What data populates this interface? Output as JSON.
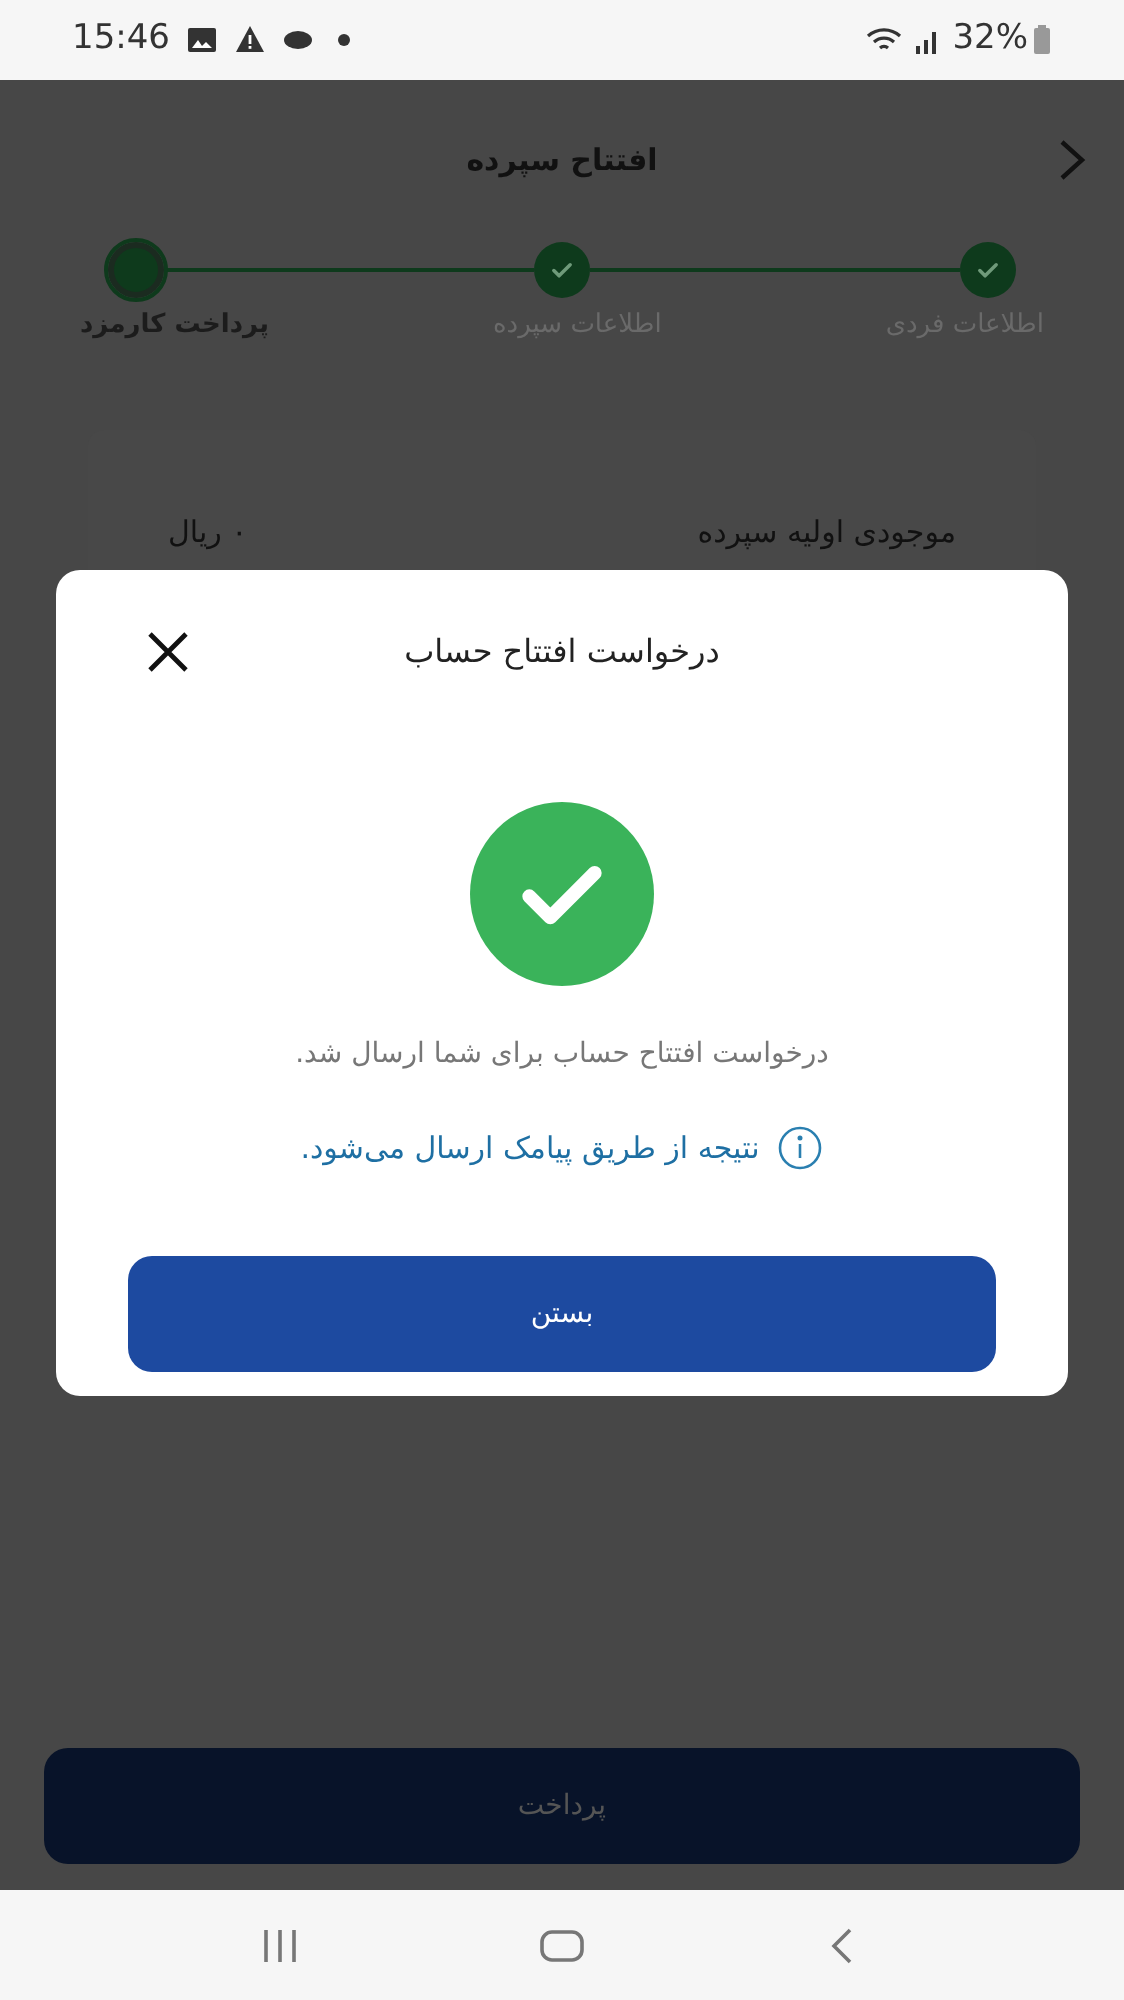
{
  "status_bar": {
    "time": "15:46",
    "battery": "32%"
  },
  "header": {
    "title": "افتتاح سپرده"
  },
  "steps": [
    {
      "label": "اطلاعات فردی",
      "completed": true
    },
    {
      "label": "اطلاعات سپرده",
      "completed": true
    },
    {
      "label": "پرداخت کارمزد",
      "completed": false
    }
  ],
  "summary": {
    "label": "موجودی اولیه سپرده",
    "value": "۰ ریال"
  },
  "pay_button": {
    "label": "پرداخت",
    "disabled": true
  },
  "dialog": {
    "title": "درخواست افتتاح حساب",
    "message": "درخواست افتتاح حساب برای شما ارسال شد.",
    "note": "نتیجه از طریق پیامک ارسال می‌شود.",
    "button": "بستن"
  }
}
